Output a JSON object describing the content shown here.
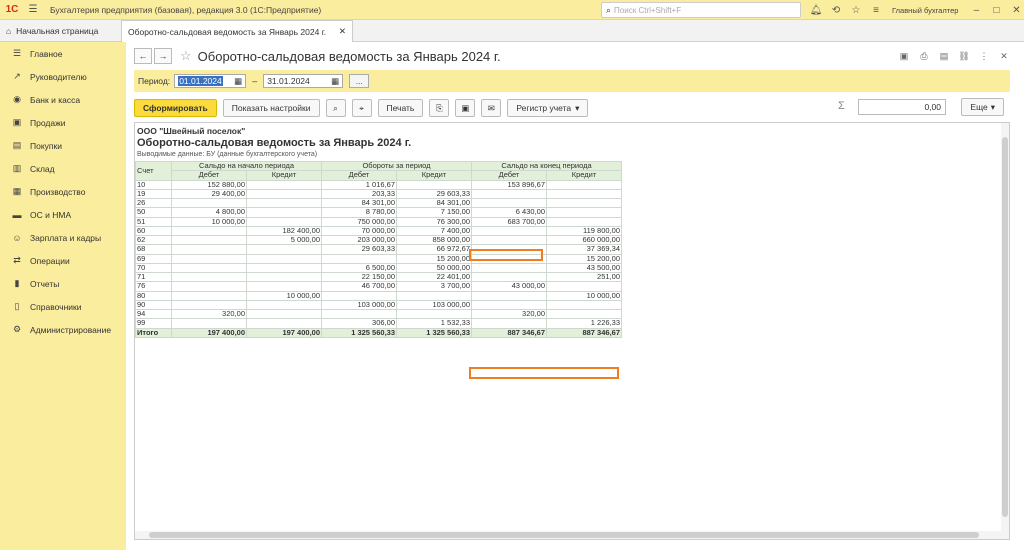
{
  "app": {
    "title": "Бухгалтерия предприятия (базовая), редакция 3.0  (1С:Предприятие)",
    "search_placeholder": "Поиск Ctrl+Shift+F",
    "user": "Главный бухгалтер",
    "logo": "1С"
  },
  "tabs": {
    "home": "Начальная страница",
    "document": "Оборотно-сальдовая ведомость за Январь 2024 г."
  },
  "sidebar": {
    "items": [
      {
        "label": "Главное",
        "icon": "menu-icon"
      },
      {
        "label": "Руководителю",
        "icon": "chart-icon"
      },
      {
        "label": "Банк и касса",
        "icon": "coins-icon"
      },
      {
        "label": "Продажи",
        "icon": "bag-icon"
      },
      {
        "label": "Покупки",
        "icon": "cart-icon"
      },
      {
        "label": "Склад",
        "icon": "warehouse-icon"
      },
      {
        "label": "Производство",
        "icon": "factory-icon"
      },
      {
        "label": "ОС и НМА",
        "icon": "truck-icon"
      },
      {
        "label": "Зарплата и кадры",
        "icon": "people-icon"
      },
      {
        "label": "Операции",
        "icon": "operations-icon"
      },
      {
        "label": "Отчеты",
        "icon": "reports-icon"
      },
      {
        "label": "Справочники",
        "icon": "books-icon"
      },
      {
        "label": "Администрирование",
        "icon": "gear-icon"
      }
    ]
  },
  "document": {
    "title": "Оборотно-сальдовая ведомость за Январь 2024 г.",
    "period_label": "Период:",
    "date_from": "01.01.2024",
    "date_to": "31.01.2024",
    "dash": "–",
    "ellipsis": "...",
    "generate_button": "Сформировать",
    "settings_button": "Показать настройки",
    "print_button": "Печать",
    "register_button": "Регистр учета",
    "sum_value": "0,00",
    "more_button": "Еще"
  },
  "report": {
    "org": "ООО \"Швейный поселок\"",
    "title": "Оборотно-сальдовая ведомость за Январь 2024 г.",
    "subtitle": "Выводимые данные:  БУ (данные бухгалтерского учета)",
    "headers": {
      "account": "Счет",
      "opening": "Сальдо на начало периода",
      "turnover": "Обороты за период",
      "closing": "Сальдо на конец периода",
      "debit": "Дебет",
      "credit": "Кредит"
    },
    "rows": [
      [
        "10",
        "152 880,00",
        "",
        "1 016,67",
        "",
        "153 896,67",
        ""
      ],
      [
        "19",
        "29 400,00",
        "",
        "203,33",
        "29 603,33",
        "",
        ""
      ],
      [
        "26",
        "",
        "",
        "84 301,00",
        "84 301,00",
        "",
        ""
      ],
      [
        "50",
        "4 800,00",
        "",
        "8 780,00",
        "7 150,00",
        "6 430,00",
        ""
      ],
      [
        "51",
        "10 000,00",
        "",
        "750 000,00",
        "76 300,00",
        "683 700,00",
        ""
      ],
      [
        "60",
        "",
        "182 400,00",
        "70 000,00",
        "7 400,00",
        "",
        "119 800,00"
      ],
      [
        "62",
        "",
        "5 000,00",
        "203 000,00",
        "858 000,00",
        "",
        "660 000,00"
      ],
      [
        "68",
        "",
        "",
        "29 603,33",
        "66 972,67",
        "",
        "37 369,34"
      ],
      [
        "69",
        "",
        "",
        "",
        "15 200,00",
        "",
        "15 200,00"
      ],
      [
        "70",
        "",
        "",
        "6 500,00",
        "50 000,00",
        "",
        "43 500,00"
      ],
      [
        "71",
        "",
        "",
        "22 150,00",
        "22 401,00",
        "",
        "251,00"
      ],
      [
        "76",
        "",
        "",
        "46 700,00",
        "3 700,00",
        "43 000,00",
        ""
      ],
      [
        "80",
        "",
        "10 000,00",
        "",
        "",
        "",
        "10 000,00"
      ],
      [
        "90",
        "",
        "",
        "103 000,00",
        "103 000,00",
        "",
        ""
      ],
      [
        "94",
        "320,00",
        "",
        "",
        "",
        "320,00",
        ""
      ],
      [
        "99",
        "",
        "",
        "306,00",
        "1 532,33",
        "",
        "1 226,33"
      ]
    ],
    "total": [
      "Итого",
      "197 400,00",
      "197 400,00",
      "1 325 560,33",
      "1 325 560,33",
      "887 346,67",
      "887 346,67"
    ]
  },
  "colors": {
    "sidebar_bg": "#fbed9e",
    "primary_button": "#fbdb3c",
    "table_header": "#e2efd9",
    "highlight": "#ef7d22"
  }
}
